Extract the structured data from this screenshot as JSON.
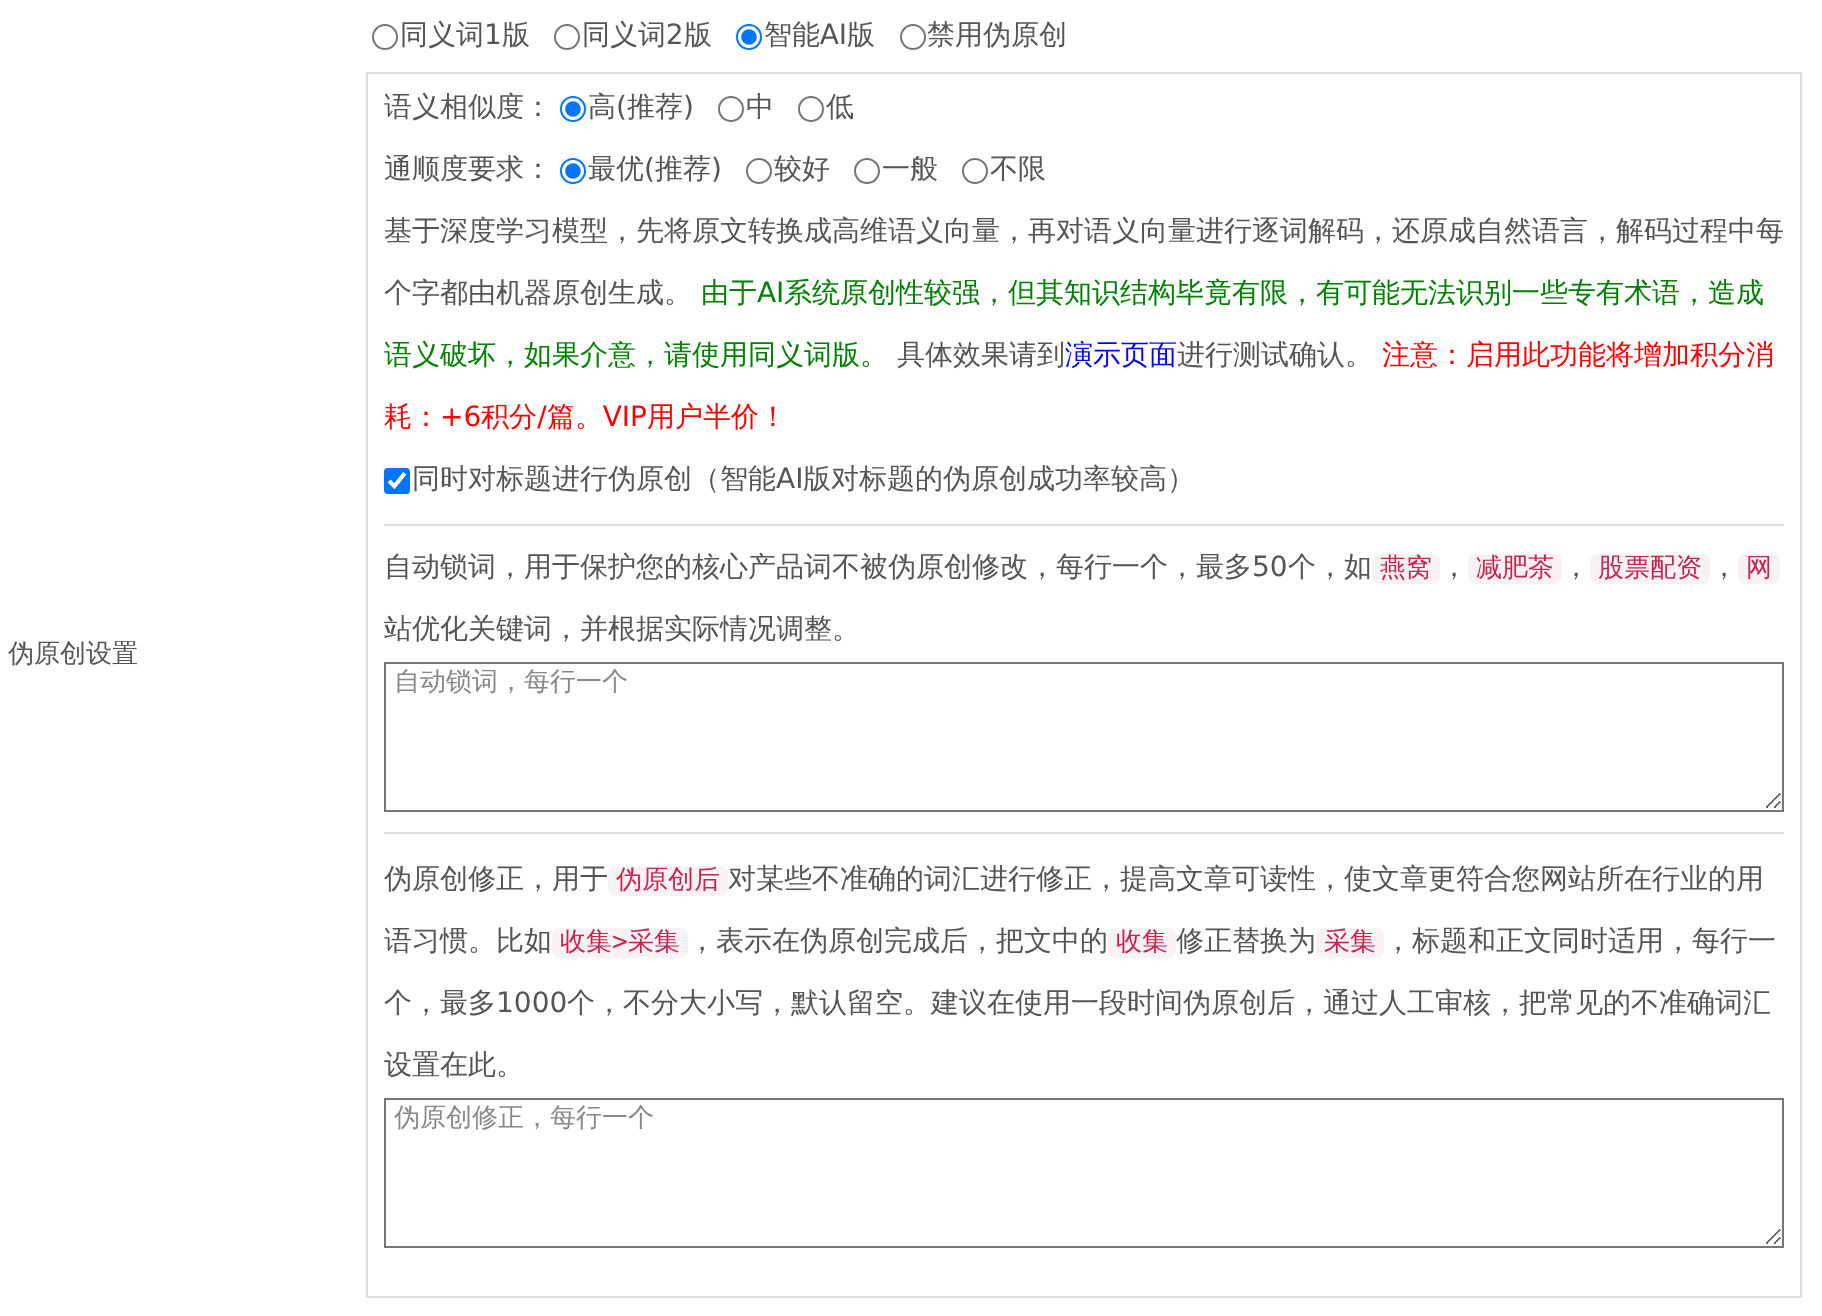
{
  "setting_label": "伪原创设置",
  "modes": [
    {
      "label": "同义词1版",
      "selected": false
    },
    {
      "label": "同义词2版",
      "selected": false
    },
    {
      "label": "智能AI版",
      "selected": true
    },
    {
      "label": "禁用伪原创",
      "selected": false
    }
  ],
  "option_groups": [
    {
      "label": "语义相似度：",
      "options": [
        {
          "label": "高(推荐)",
          "selected": true
        },
        {
          "label": "中",
          "selected": false
        },
        {
          "label": "低",
          "selected": false
        }
      ]
    },
    {
      "label": "通顺度要求：",
      "options": [
        {
          "label": "最优(推荐)",
          "selected": true
        },
        {
          "label": "较好",
          "selected": false
        },
        {
          "label": "一般",
          "selected": false
        },
        {
          "label": "不限",
          "selected": false
        }
      ]
    }
  ],
  "ai_description": [
    {
      "kind": "text",
      "text": "基于深度学习模型，先将原文转换成高维语义向量，再对语义向量进行逐词解码，还原成自然语言，解码过程中每个字都由机器原创生成。 "
    },
    {
      "kind": "green",
      "text": "由于AI系统原创性较强，但其知识结构毕竟有限，有可能无法识别一些专有术语，造成语义破坏，如果介意，请使用同义词版。"
    },
    {
      "kind": "text",
      "text": " 具体效果请到"
    },
    {
      "kind": "link",
      "text": "演示页面"
    },
    {
      "kind": "text",
      "text": "进行测试确认。 "
    },
    {
      "kind": "red",
      "text": "注意：启用此功能将增加积分消耗：+6积分/篇。VIP用户半价！"
    }
  ],
  "title_option": {
    "label": "同时对标题进行伪原创（智能AI版对标题的伪原创成功率较高）",
    "checked": true
  },
  "lock_words": {
    "description": [
      {
        "kind": "text",
        "text": "自动锁词，用于保护您的核心产品词不被伪原创修改，每行一个，最多50个，如"
      },
      {
        "kind": "code",
        "text": "燕窝"
      },
      {
        "kind": "text",
        "text": "，"
      },
      {
        "kind": "code",
        "text": "减肥茶"
      },
      {
        "kind": "text",
        "text": "，"
      },
      {
        "kind": "code",
        "text": "股票配资"
      },
      {
        "kind": "text",
        "text": "，"
      },
      {
        "kind": "code",
        "text": "网"
      },
      {
        "kind": "text",
        "text": "站优化关键词，并根据实际情况调整。"
      }
    ],
    "placeholder": "自动锁词，每行一个"
  },
  "corrections": {
    "description": [
      {
        "kind": "text",
        "text": "伪原创修正，用于"
      },
      {
        "kind": "code",
        "text": "伪原创后"
      },
      {
        "kind": "text",
        "text": "对某些不准确的词汇进行修正，提高文章可读性，使文章更符合您网站所在行业的用语习惯。比如"
      },
      {
        "kind": "code",
        "text": "收集>采集"
      },
      {
        "kind": "text",
        "text": "，表示在伪原创完成后，把文中的"
      },
      {
        "kind": "code",
        "text": "收集"
      },
      {
        "kind": "text",
        "text": "修正替换为"
      },
      {
        "kind": "code",
        "text": "采集"
      },
      {
        "kind": "text",
        "text": "，标题和正文同时适用，每行一个，最多1000个，不分大小写，默认留空。建议在使用一段时间伪原创后，通过人工审核，把常见的不准确词汇设置在此。"
      }
    ],
    "placeholder": "伪原创修正，每行一个"
  }
}
